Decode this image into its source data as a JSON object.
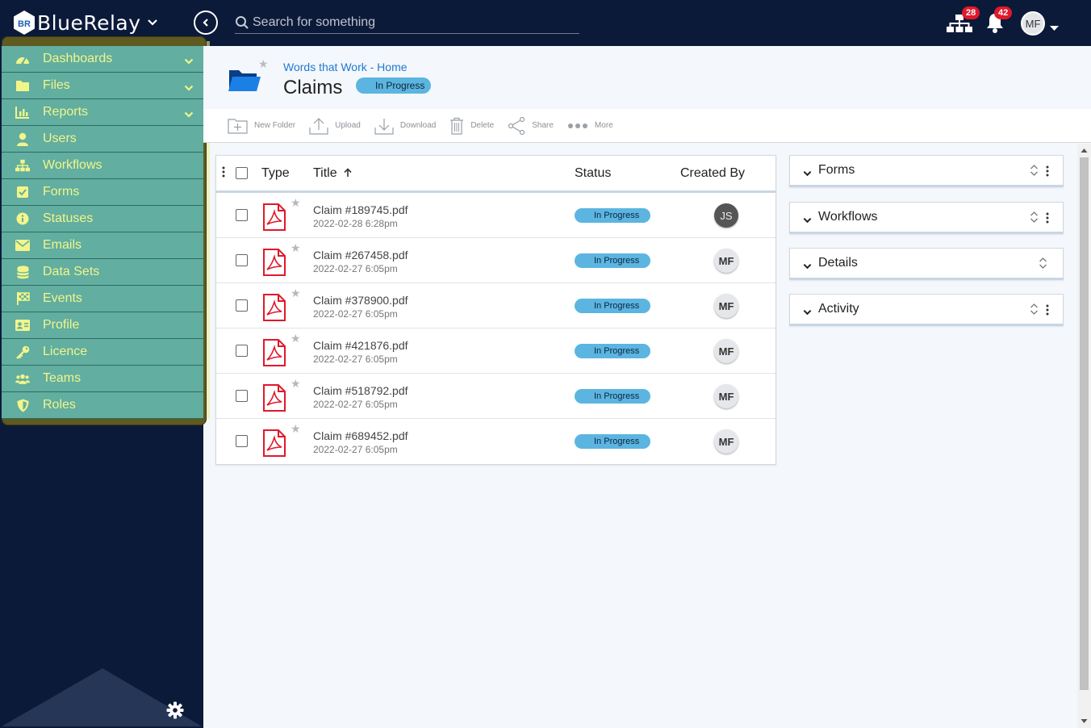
{
  "app": {
    "name": "BlueRelay",
    "logo_mark": "BR"
  },
  "search": {
    "placeholder": "Search for something"
  },
  "notifications": {
    "workflow_count": "28",
    "alert_count": "42"
  },
  "user": {
    "initials": "MF"
  },
  "sidebar": {
    "items": [
      {
        "label": "Dashboards",
        "icon": "dashboard-icon",
        "expandable": true
      },
      {
        "label": "Files",
        "icon": "folder-icon",
        "expandable": true
      },
      {
        "label": "Reports",
        "icon": "chart-icon",
        "expandable": true
      },
      {
        "label": "Users",
        "icon": "user-icon",
        "expandable": false
      },
      {
        "label": "Workflows",
        "icon": "sitemap-icon",
        "expandable": false
      },
      {
        "label": "Forms",
        "icon": "checkbox-icon",
        "expandable": false
      },
      {
        "label": "Statuses",
        "icon": "info-icon",
        "expandable": false
      },
      {
        "label": "Emails",
        "icon": "envelope-icon",
        "expandable": false
      },
      {
        "label": "Data Sets",
        "icon": "database-icon",
        "expandable": false
      },
      {
        "label": "Events",
        "icon": "flag-icon",
        "expandable": false
      },
      {
        "label": "Profile",
        "icon": "id-card-icon",
        "expandable": false
      },
      {
        "label": "Licence",
        "icon": "key-icon",
        "expandable": false
      },
      {
        "label": "Teams",
        "icon": "users-icon",
        "expandable": false
      },
      {
        "label": "Roles",
        "icon": "shield-icon",
        "expandable": false
      }
    ]
  },
  "header": {
    "breadcrumb": "Words that Work - Home",
    "title": "Claims",
    "status": "In Progress"
  },
  "toolbar": {
    "new_folder": "New Folder",
    "upload": "Upload",
    "download": "Download",
    "delete": "Delete",
    "share": "Share",
    "more": "More"
  },
  "table": {
    "columns": {
      "type": "Type",
      "title": "Title",
      "status": "Status",
      "created_by": "Created By"
    },
    "rows": [
      {
        "name": "Claim #189745.pdf",
        "date": "2022-02-28 6:28pm",
        "status": "In Progress",
        "creator": "JS"
      },
      {
        "name": "Claim #267458.pdf",
        "date": "2022-02-27 6:05pm",
        "status": "In Progress",
        "creator": "MF"
      },
      {
        "name": "Claim #378900.pdf",
        "date": "2022-02-27 6:05pm",
        "status": "In Progress",
        "creator": "MF"
      },
      {
        "name": "Claim #421876.pdf",
        "date": "2022-02-27 6:05pm",
        "status": "In Progress",
        "creator": "MF"
      },
      {
        "name": "Claim #518792.pdf",
        "date": "2022-02-27 6:05pm",
        "status": "In Progress",
        "creator": "MF"
      },
      {
        "name": "Claim #689452.pdf",
        "date": "2022-02-27 6:05pm",
        "status": "In Progress",
        "creator": "MF"
      }
    ]
  },
  "panels": [
    {
      "title": "Forms",
      "menu": true
    },
    {
      "title": "Workflows",
      "menu": true
    },
    {
      "title": "Details",
      "menu": false
    },
    {
      "title": "Activity",
      "menu": true
    }
  ],
  "colors": {
    "topbar": "#0c1a3a",
    "nav_item": "#62aea0",
    "nav_text": "#f2f58a",
    "status_pill": "#5bb5e0",
    "pdf_red": "#e0192b",
    "link": "#1f7ad1"
  }
}
